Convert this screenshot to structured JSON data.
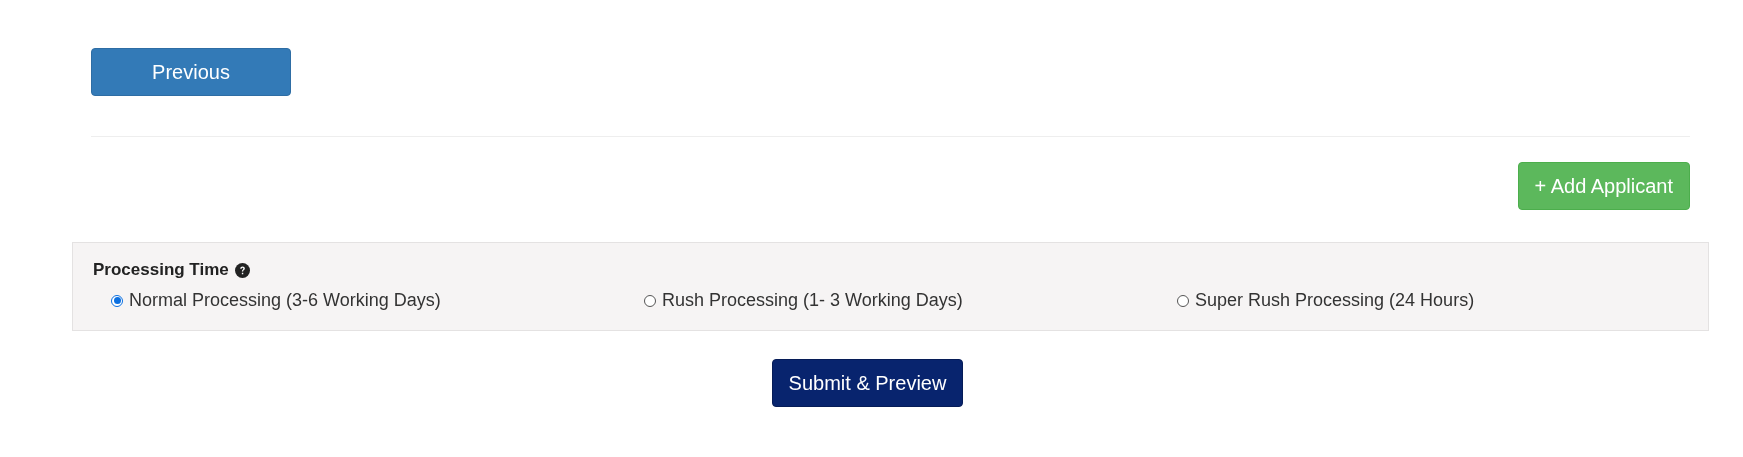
{
  "previous_button": {
    "label": "Previous"
  },
  "add_applicant_button": {
    "label": "+ Add Applicant"
  },
  "processing_time": {
    "title": "Processing Time",
    "options": [
      {
        "label": "Normal Processing (3-6 Working Days)",
        "selected": true
      },
      {
        "label": "Rush Processing (1- 3 Working Days)",
        "selected": false
      },
      {
        "label": "Super Rush Processing (24 Hours)",
        "selected": false
      }
    ]
  },
  "submit_button": {
    "label": "Submit & Preview"
  }
}
